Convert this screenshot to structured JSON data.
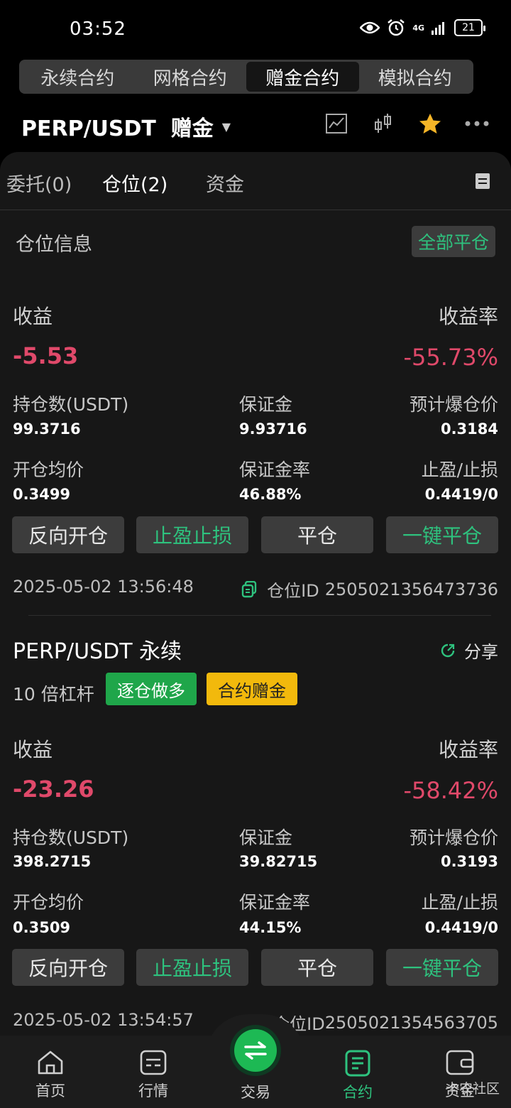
{
  "status_bar": {
    "time": "03:52",
    "network": "4G",
    "battery": "21"
  },
  "mode_tabs": [
    "永续合约",
    "网格合约",
    "赠金合约",
    "模拟合约"
  ],
  "pair": {
    "title": "PERP/USDT  赠金"
  },
  "sub_tabs": [
    "委托(0)",
    "仓位(2)",
    "资金"
  ],
  "positions_section": {
    "title": "仓位信息",
    "close_all": "全部平仓"
  },
  "labels": {
    "pnl": "收益",
    "pnl_rate": "收益率",
    "size": "持仓数(USDT)",
    "margin": "保证金",
    "liq_price": "预计爆仓价",
    "entry_price": "开仓均价",
    "margin_rate": "保证金率",
    "tp_sl": "止盈/止损",
    "id_prefix": "仓位ID "
  },
  "buttons": {
    "reverse": "反向开仓",
    "tpsl": "止盈止损",
    "close": "平仓",
    "one_click_close": "一键平仓"
  },
  "position1": {
    "pnl": "-5.53",
    "pnl_rate": "-55.73%",
    "size": "99.3716",
    "margin": "9.93716",
    "liq_price": "0.3184",
    "entry_price": "0.3499",
    "margin_rate": "46.88%",
    "tp_sl": "0.4419/0",
    "time": "2025-05-02 13:56:48",
    "id": "2505021356473736"
  },
  "position2": {
    "title": "PERP/USDT 永续",
    "share": "分享",
    "leverage": "10 倍杠杆",
    "tag_mode": "逐仓做多",
    "tag_bonus": "合约赠金",
    "pnl": "-23.26",
    "pnl_rate": "-58.42%",
    "size": "398.2715",
    "margin": "39.82715",
    "liq_price": "0.3193",
    "entry_price": "0.3509",
    "margin_rate": "44.15%",
    "tp_sl": "0.4419/0",
    "time": "2025-05-02 13:54:57",
    "id": "2505021354563705"
  },
  "bottom_nav": {
    "home": "首页",
    "market": "行情",
    "trade": "交易",
    "contract": "合约",
    "assets": "资金"
  },
  "watermark": "卡农社区",
  "colors": {
    "accent_green": "#2ec27e",
    "loss_red": "#e0496a",
    "bonus_yellow": "#f2b90c"
  }
}
